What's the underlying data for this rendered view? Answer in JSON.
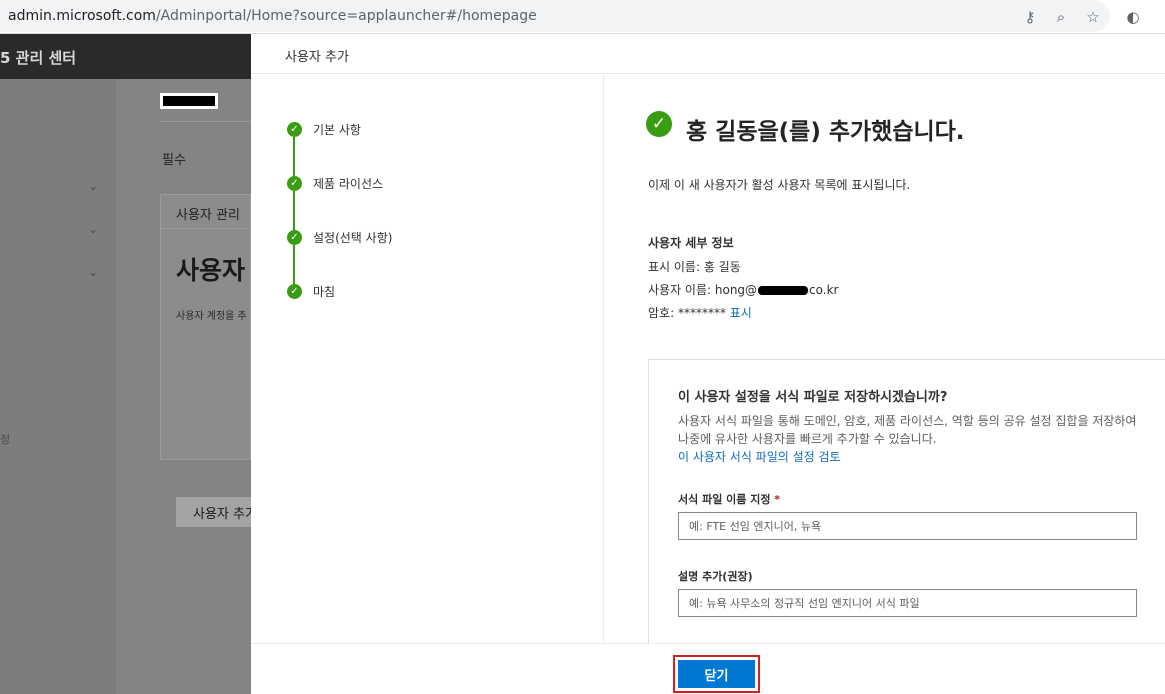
{
  "browser": {
    "url_host": "admin.microsoft.com",
    "url_path": "/Adminportal/Home?source=applauncher#/homepage"
  },
  "background": {
    "header_title": "5 관리 센터",
    "required_label": "필수",
    "card_header": "사용자 관리",
    "card_big_text": "사용자",
    "card_small_text": "사용자 계정을 추",
    "card_button": "사용자 추가",
    "nav_fragment": "정"
  },
  "panel": {
    "title": "사용자 추가",
    "steps": [
      {
        "label": "기본 사항"
      },
      {
        "label": "제품 라이선스"
      },
      {
        "label": "설정(선택 사항)"
      },
      {
        "label": "마침"
      }
    ],
    "success_title": "홍 길동을(를) 추가했습니다.",
    "info_line": "이제 이 새 사용자가 활성 사용자 목록에 표시됩니다.",
    "details": {
      "heading": "사용자 세부 정보",
      "display_name": "표시 이름: 홍 길동",
      "username_prefix": "사용자 이름: hong@",
      "username_suffix": "co.kr",
      "password": "암호: ******** ",
      "show_link": "표시"
    },
    "template": {
      "question": "이 사용자 설정을 서식 파일로 저장하시겠습니까?",
      "description": "사용자 서식 파일을 통해 도메인, 암호, 제품 라이선스, 역할 등의 공유 설정 집합을 저장하여 나중에 유사한 사용자를 빠르게 추가할 수 있습니다.",
      "review_link": "이 사용자 서식 파일의 설정 검토",
      "name_label": "서식 파일 이름 지정",
      "name_required": "*",
      "name_placeholder": "예: FTE 선임 엔지니어, 뉴욕",
      "desc_label": "설명 추가(권장)",
      "desc_placeholder": "예: 뉴욕 사무소의 정규직 선임 엔지니어 서식 파일"
    },
    "close_button": "닫기"
  },
  "colors": {
    "accent_blue": "#0078d4",
    "success_green": "#3a9c12",
    "highlight_red": "#d21f21"
  }
}
